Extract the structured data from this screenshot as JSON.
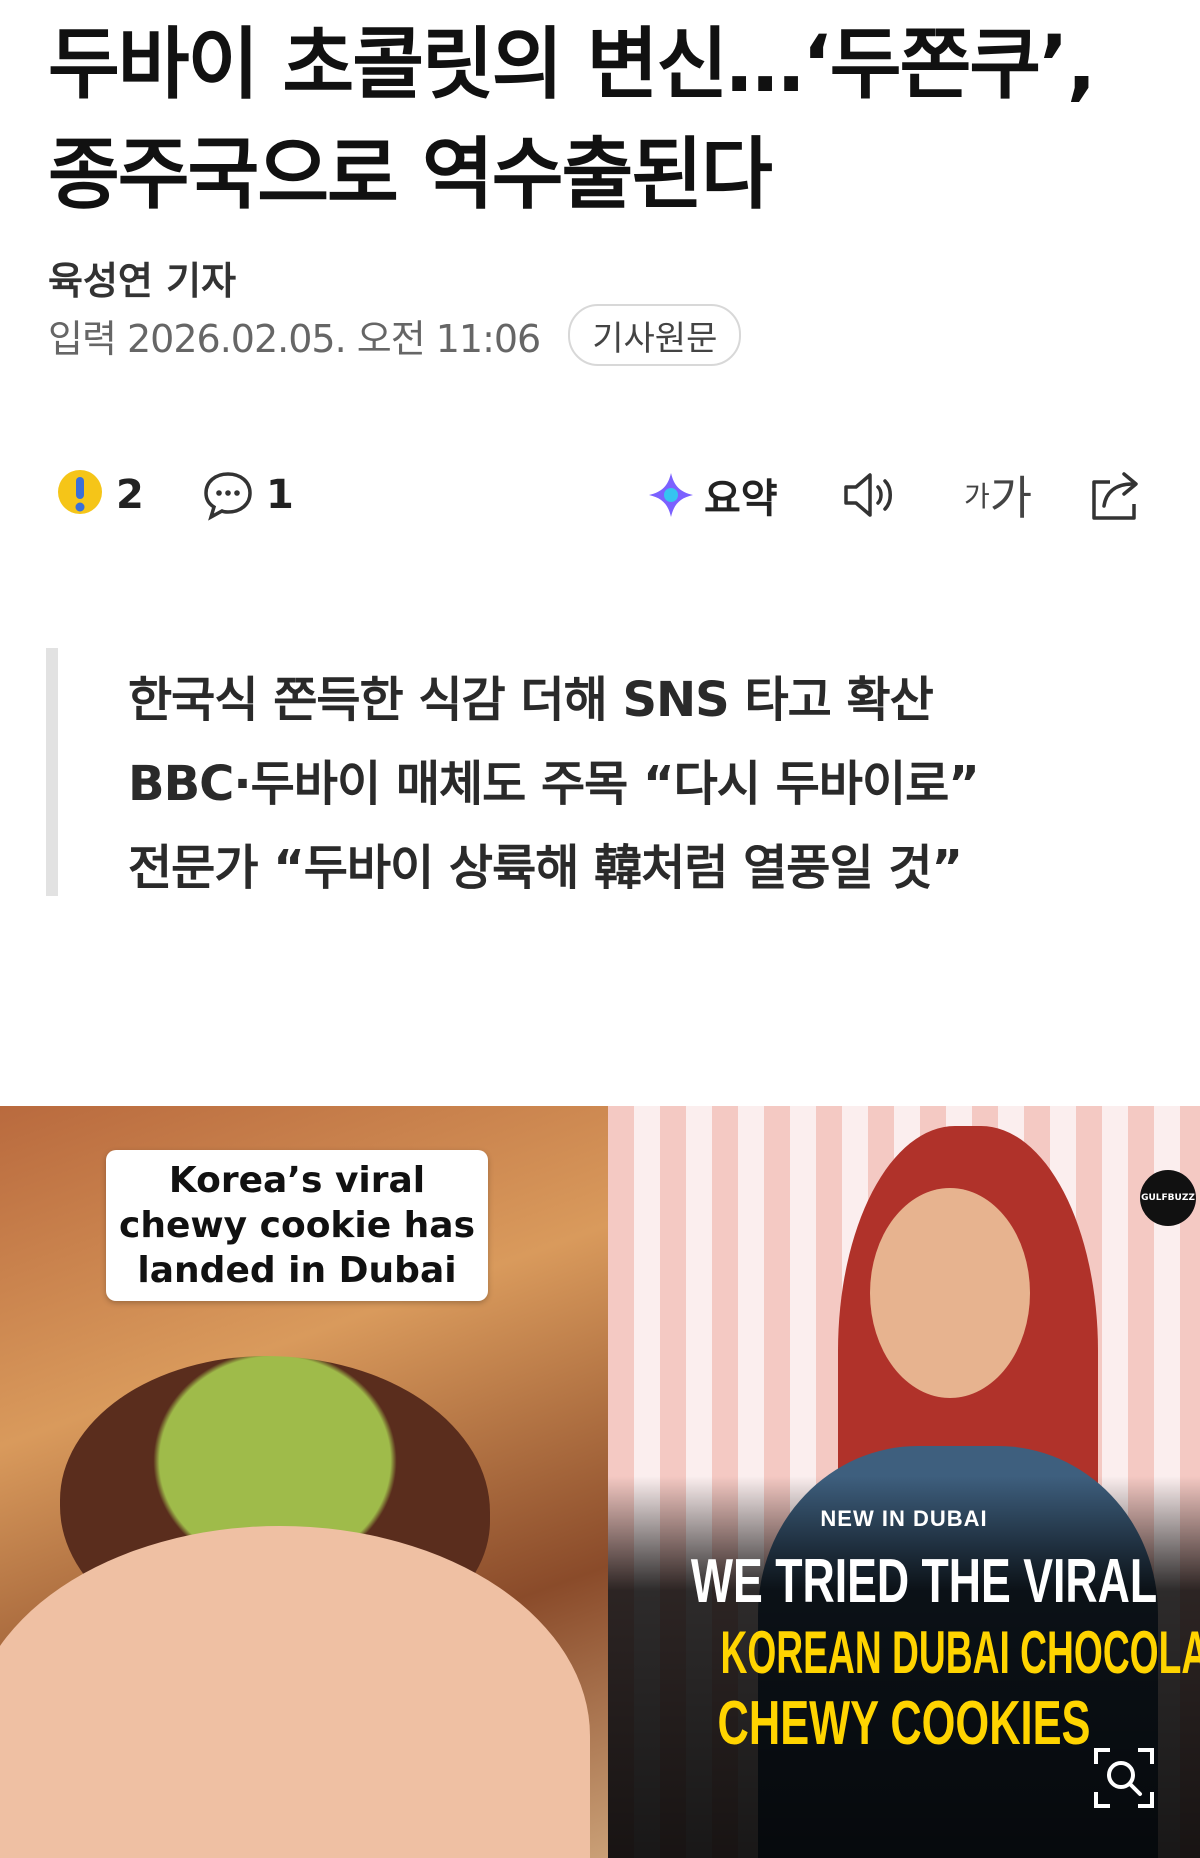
{
  "article": {
    "title": "두바이 초콜릿의 변신…‘두쫀쿠’, 종주국으로 역수출된다",
    "reporter": "육성연 기자",
    "date": "입력 2026.02.05. 오전 11:06",
    "source_button": "기사원문"
  },
  "toolbar": {
    "reaction_count": "2",
    "comment_count": "1",
    "summary_label": "요약",
    "font_small": "가",
    "font_big": "가"
  },
  "subheadlines": [
    "한국식 쫀득한 식감 더해 SNS 타고 확산",
    "BBC·두바이 매체도 주목 “다시 두바이로”",
    "전문가 “두바이 상륙해 韓처럼 열풍일 것”"
  ],
  "photo": {
    "left_caption": [
      "Korea’s viral",
      "chewy cookie has",
      "landed in Dubai"
    ],
    "right_logo": "GULFBUZZ",
    "right_overlay": {
      "kicker": "NEW IN DUBAI",
      "line1": "WE TRIED THE VIRAL",
      "line2": "KOREAN DUBAI CHOCOLATE",
      "line3": "CHEWY COOKIES"
    }
  },
  "colors": {
    "accent_yellow": "#ffd400",
    "reaction_yellow": "#f5c518",
    "summary_purple": "#7b61ff"
  },
  "icons": [
    "exclamation-reaction-icon",
    "comment-icon",
    "summary-sparkle-icon",
    "speaker-icon",
    "font-size-icon",
    "share-icon",
    "zoom-icon"
  ]
}
